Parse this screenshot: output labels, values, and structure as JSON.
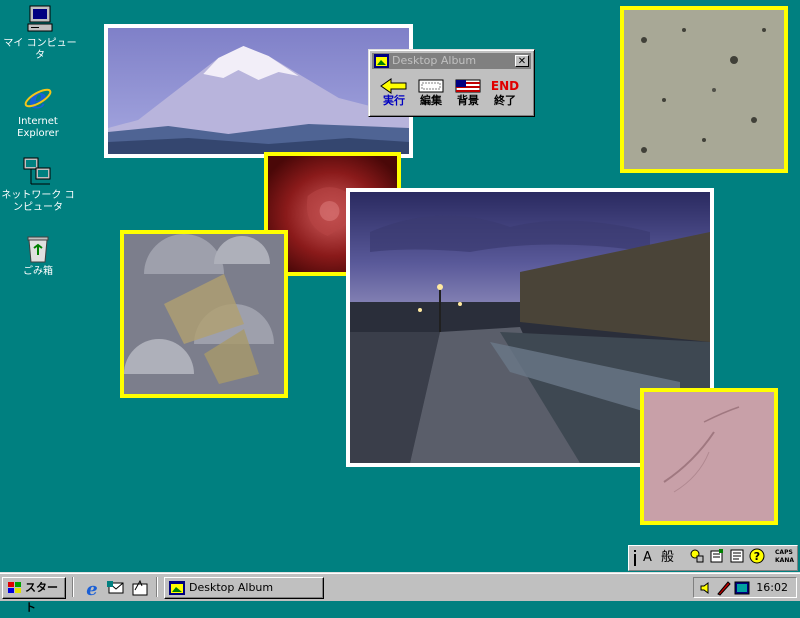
{
  "desktop": {
    "icons": [
      {
        "name": "my-computer",
        "label": "マイ コンピュータ"
      },
      {
        "name": "internet-explorer",
        "label": "Internet Explorer"
      },
      {
        "name": "network",
        "label": "ネットワーク コンピュータ"
      },
      {
        "name": "recycle-bin",
        "label": "ごみ箱"
      }
    ],
    "background_color": "#008080",
    "frame_colors": {
      "white": "#ffffff",
      "yellow": "#ffff00"
    }
  },
  "album_window": {
    "title": "Desktop Album",
    "close_label": "✕",
    "buttons": [
      {
        "label": "実行",
        "icon": "arrow-left-icon"
      },
      {
        "label": "編集",
        "icon": "frame-icon"
      },
      {
        "label": "背景",
        "icon": "flag-icon"
      },
      {
        "label": "終了",
        "icon_text": "END"
      }
    ]
  },
  "ime_bar": {
    "mode_a": "A",
    "mode_kanji": "般",
    "caps": "CAPS",
    "kana": "KANA"
  },
  "taskbar": {
    "start_label": "スタート",
    "task_label": "Desktop Album",
    "clock": "16:02"
  }
}
